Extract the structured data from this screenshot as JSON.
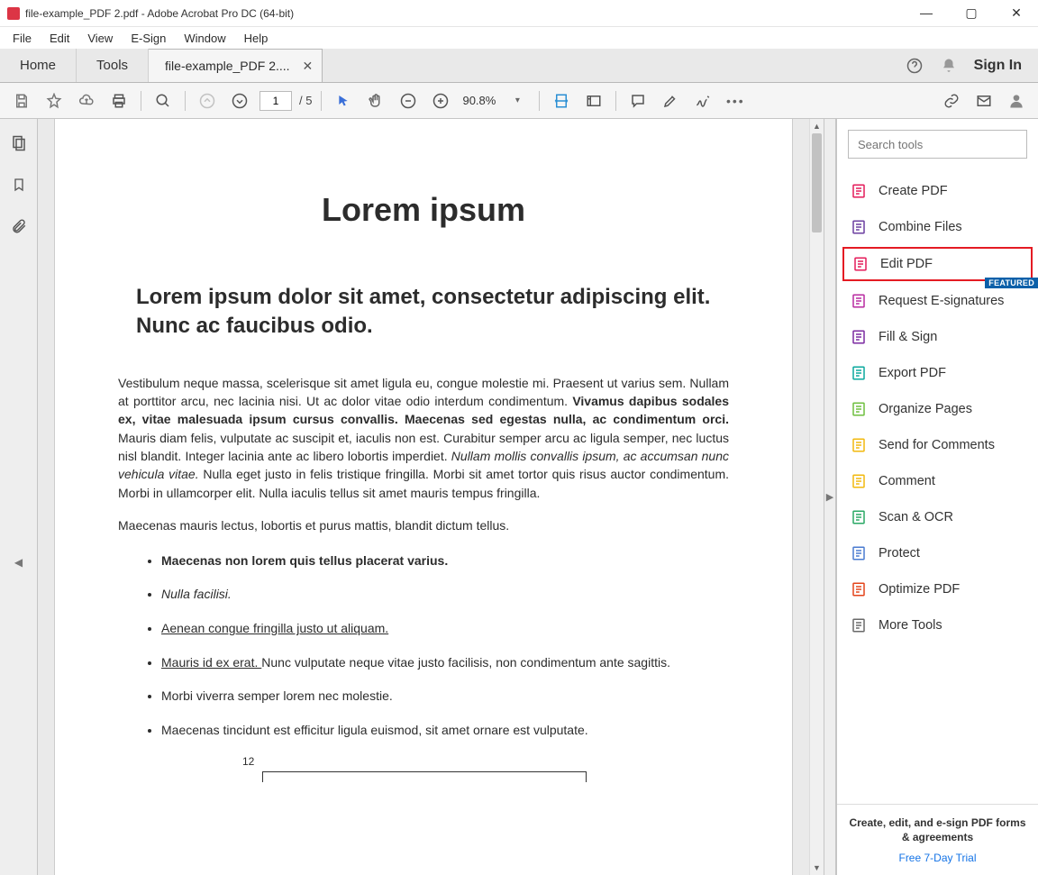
{
  "titlebar": {
    "text": "file-example_PDF 2.pdf - Adobe Acrobat Pro DC (64-bit)"
  },
  "menubar": {
    "items": [
      "File",
      "Edit",
      "View",
      "E-Sign",
      "Window",
      "Help"
    ]
  },
  "tabbar": {
    "home": "Home",
    "tools": "Tools",
    "doc_tab": "file-example_PDF 2....",
    "signin": "Sign In"
  },
  "toolbar": {
    "page_current": "1",
    "page_total": "/ 5",
    "zoom": "90.8%"
  },
  "right": {
    "search_placeholder": "Search tools",
    "tools": [
      {
        "label": "Create PDF",
        "color": "#e41b5a"
      },
      {
        "label": "Combine Files",
        "color": "#6b3fa0"
      },
      {
        "label": "Edit PDF",
        "color": "#e41b5a",
        "highlight": true
      },
      {
        "label": "Request E-signatures",
        "color": "#b82aa0",
        "badge": "FEATURED"
      },
      {
        "label": "Fill & Sign",
        "color": "#7b2aa0"
      },
      {
        "label": "Export PDF",
        "color": "#0aa89e"
      },
      {
        "label": "Organize Pages",
        "color": "#6fbf3f"
      },
      {
        "label": "Send for Comments",
        "color": "#f2b90f"
      },
      {
        "label": "Comment",
        "color": "#f2b90f"
      },
      {
        "label": "Scan & OCR",
        "color": "#2aa865"
      },
      {
        "label": "Protect",
        "color": "#4a7bd0"
      },
      {
        "label": "Optimize PDF",
        "color": "#e4451b"
      },
      {
        "label": "More Tools",
        "color": "#6a6a6a"
      }
    ],
    "bottom_msg": "Create, edit, and e-sign PDF forms & agreements",
    "trial": "Free 7-Day Trial"
  },
  "doc": {
    "title": "Lorem ipsum",
    "lead": "   Lorem ipsum dolor sit amet, consectetur adipiscing elit. Nunc ac faucibus odio.",
    "p1_a": "Vestibulum neque massa, scelerisque sit amet ligula eu, congue molestie mi. Praesent ut varius sem. Nullam at porttitor arcu, nec lacinia nisi. Ut ac dolor vitae odio interdum condimentum. ",
    "p1_b": "Vivamus dapibus sodales ex, vitae malesuada ipsum cursus convallis. Maecenas sed egestas nulla, ac condimentum orci.",
    "p1_c": " Mauris diam felis, vulputate ac suscipit et, iaculis non est. Curabitur semper arcu ac ligula semper, nec luctus nisl blandit. Integer lacinia ante ac libero lobortis imperdiet. ",
    "p1_d": "Nullam mollis convallis ipsum, ac accumsan nunc vehicula vitae.",
    "p1_e": " Nulla eget justo in felis tristique fringilla. Morbi sit amet tortor quis risus auctor condimentum. Morbi in ullamcorper elit. Nulla iaculis tellus sit amet mauris tempus fringilla.",
    "p2": "Maecenas mauris lectus, lobortis et purus mattis, blandit dictum tellus.",
    "li1": "Maecenas non lorem quis tellus placerat varius.",
    "li2": "Nulla facilisi.",
    "li3": "Aenean congue fringilla justo ut aliquam. ",
    "li4_a": "Mauris id ex erat. ",
    "li4_b": "Nunc vulputate neque vitae justo facilisis, non condimentum ante sagittis.",
    "li5": "Morbi viverra semper lorem nec molestie.",
    "li6": "Maecenas tincidunt est efficitur ligula euismod, sit amet ornare est vulputate.",
    "figlabel": "12"
  }
}
